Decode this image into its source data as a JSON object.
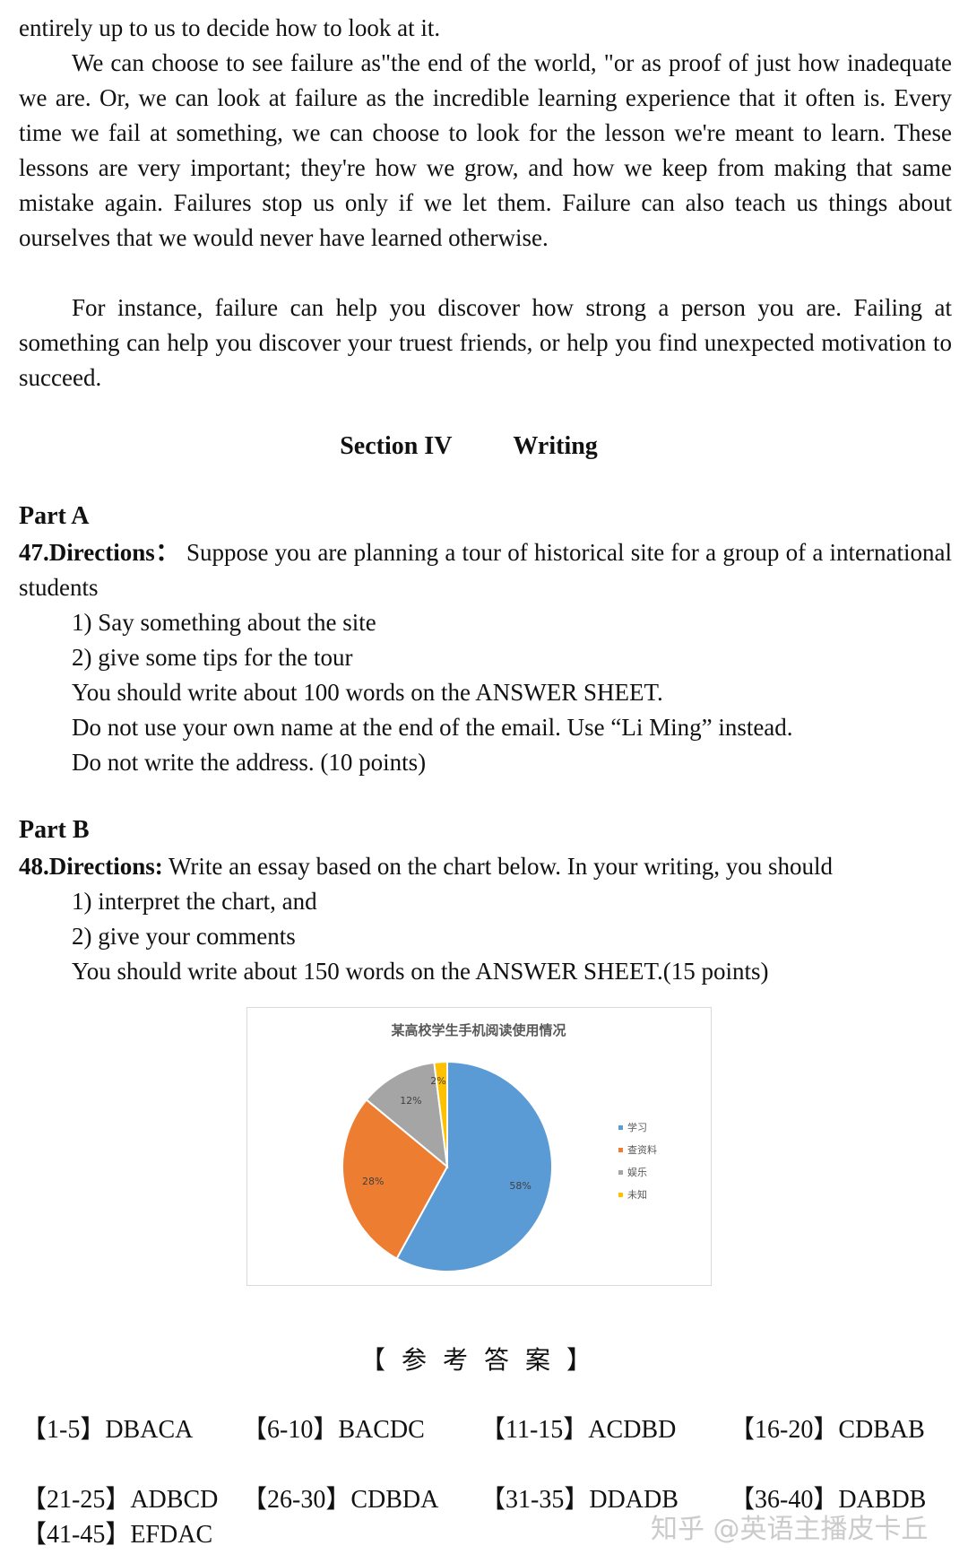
{
  "passage": {
    "line0": "entirely up to us to decide how to look at it.",
    "para1": "We can choose to see failure as\"the end of the world, \"or as proof of just how inadequate we are. Or, we can look at failure as the incredible learning experience that it often is. Every time we fail at something, we can choose to look for the lesson we're meant to learn. These lessons are very important; they're how we grow, and how we keep from making that same mistake again. Failures stop us only if we let them. Failure can also teach us things about ourselves that we would never have learned otherwise.",
    "para2": "For instance, failure can help you discover how strong a person you are. Failing at something can help you discover your truest friends, or help you find unexpected motivation to succeed."
  },
  "section": {
    "label": "Section IV",
    "name": "Writing"
  },
  "part_a": {
    "heading": "Part A",
    "directions_label": "47.Directions：",
    "directions_text": " Suppose you are planning a tour of historical site for a group of a international students",
    "items": [
      "1) Say something about the site",
      "2) give some tips for the tour",
      "You should write about 100 words on the ANSWER SHEET.",
      "Do not use your own name at the end of the email. Use “Li Ming” instead.",
      "Do not write the address. (10 points)"
    ]
  },
  "part_b": {
    "heading": "Part B",
    "directions_label": "48.Directions:",
    "directions_text": " Write an essay based on the chart below. In your writing, you should",
    "items": [
      "1) interpret the chart, and",
      "2) give your comments",
      "You should write about 150 words on the ANSWER SHEET.(15 points)"
    ]
  },
  "chart_data": {
    "type": "pie",
    "title": "某高校学生手机阅读使用情况",
    "categories": [
      "学习",
      "查资料",
      "娱乐",
      "未知"
    ],
    "values": [
      58,
      28,
      12,
      2
    ],
    "labels": [
      "58%",
      "28%",
      "12%",
      "2%"
    ],
    "colors": [
      "#5b9bd5",
      "#ed7d31",
      "#a5a5a5",
      "#ffc000"
    ],
    "legend_position": "right",
    "start_angle": "12 o'clock, clockwise"
  },
  "answers": {
    "title": "【参考答案】",
    "rows": [
      [
        {
          "range": "【1-5】",
          "key": "DBACA"
        },
        {
          "range": "【6-10】",
          "key": "BACDC"
        },
        {
          "range": "【11-15】",
          "key": "ACDBD"
        },
        {
          "range": "【16-20】",
          "key": "CDBAB"
        }
      ],
      [
        {
          "range": "【21-25】",
          "key": "ADBCD"
        },
        {
          "range": "【26-30】",
          "key": "CDBDA"
        },
        {
          "range": "【31-35】",
          "key": "DDADB"
        },
        {
          "range": "【36-40】",
          "key": "DABDB"
        }
      ],
      [
        {
          "range": "【41-45】",
          "key": "EFDAC"
        }
      ]
    ]
  },
  "watermark": "知乎 @英语主播皮卡丘"
}
